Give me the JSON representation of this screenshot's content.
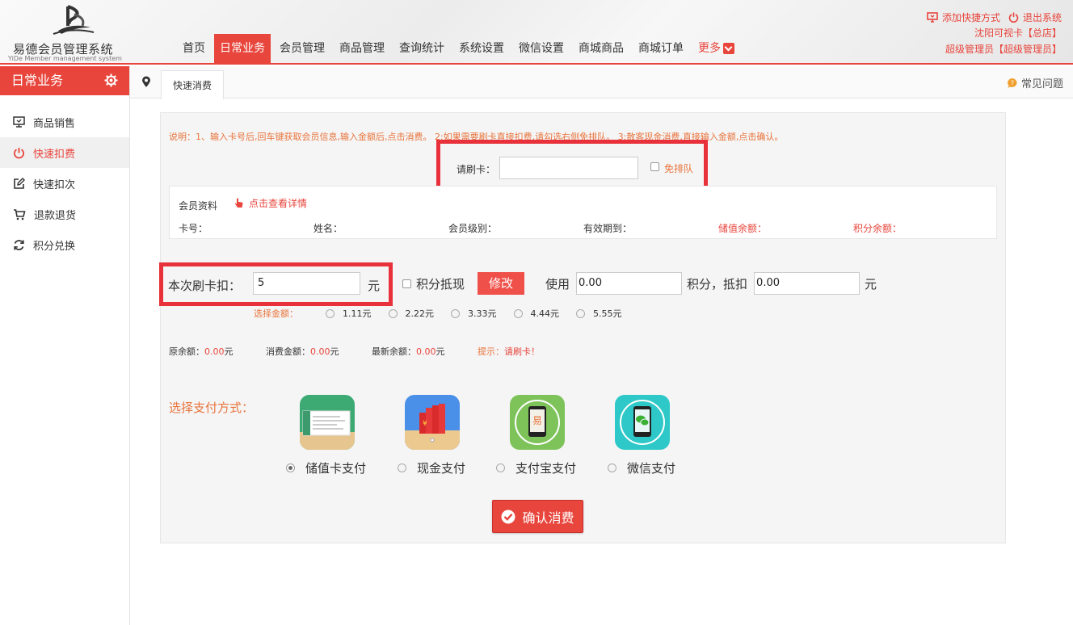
{
  "app": {
    "logo_title": "易德会员管理系统",
    "logo_subtitle": "YiDe Member management system"
  },
  "nav": {
    "items": [
      "首页",
      "日常业务",
      "会员管理",
      "商品管理",
      "查询统计",
      "系统设置",
      "微信设置",
      "商城商品",
      "商城订单",
      "更多"
    ],
    "active_index": 1
  },
  "top_right": {
    "add_shortcut": "添加快捷方式",
    "logout": "退出系统",
    "store": "沈阳可视卡【总店】",
    "user": "超级管理员【超级管理员】"
  },
  "sidebar": {
    "title": "日常业务",
    "items": [
      {
        "label": "商品销售",
        "icon": "monitor-icon"
      },
      {
        "label": "快速扣费",
        "icon": "power-icon"
      },
      {
        "label": "快速扣次",
        "icon": "edit-icon"
      },
      {
        "label": "退款退货",
        "icon": "cart-icon"
      },
      {
        "label": "积分兑换",
        "icon": "refresh-icon"
      }
    ],
    "active_index": 1
  },
  "tabs": {
    "current": "快速消费",
    "faq": "常见问题"
  },
  "form": {
    "description": "说明：1、输入卡号后,回车键获取会员信息,输入金额后,点击消费。 2:如果需要刷卡直接扣费,请勾选右侧免排队。 3:散客现金消费,直接输入金额,点击确认。",
    "swipe_label": "请刷卡：",
    "swipe_value": "",
    "skip_queue_label": "免排队",
    "member_info_title": "会员资料",
    "member_detail_link": "点击查看详情",
    "member_fields": [
      "卡号：",
      "姓名：",
      "会员级别：",
      "有效期到：",
      "储值余额：",
      "积分余额："
    ],
    "deduct_label": "本次刷卡扣：",
    "deduct_value": "5",
    "deduct_unit": "元",
    "points_offset_label": "积分抵现",
    "edit_button": "修改",
    "use_label": "使用",
    "points_value": "0.00",
    "points_mid": "积分，抵扣",
    "offset_value": "0.00",
    "offset_unit": "元",
    "amount_select_label": "选择金额：",
    "amount_options": [
      "1.11元",
      "2.22元",
      "3.33元",
      "4.44元",
      "5.55元"
    ],
    "balance_original_label": "原余额：",
    "balance_original": "0.00",
    "consume_label": "消费金额：",
    "consume_amount": "0.00",
    "balance_new_label": "最新余额：",
    "balance_new": "0.00",
    "unit_yuan": "元",
    "hint_label": "提示：",
    "hint_text": "请刷卡！",
    "pay_method_label": "选择支付方式：",
    "pay_methods": [
      "储值卡支付",
      "现金支付",
      "支付宝支付",
      "微信支付"
    ],
    "pay_selected_index": 0,
    "confirm_button": "确认消费"
  },
  "colors": {
    "accent": "#e8453c",
    "highlight_border": "#e8313a",
    "orange_text": "#e8743c"
  }
}
